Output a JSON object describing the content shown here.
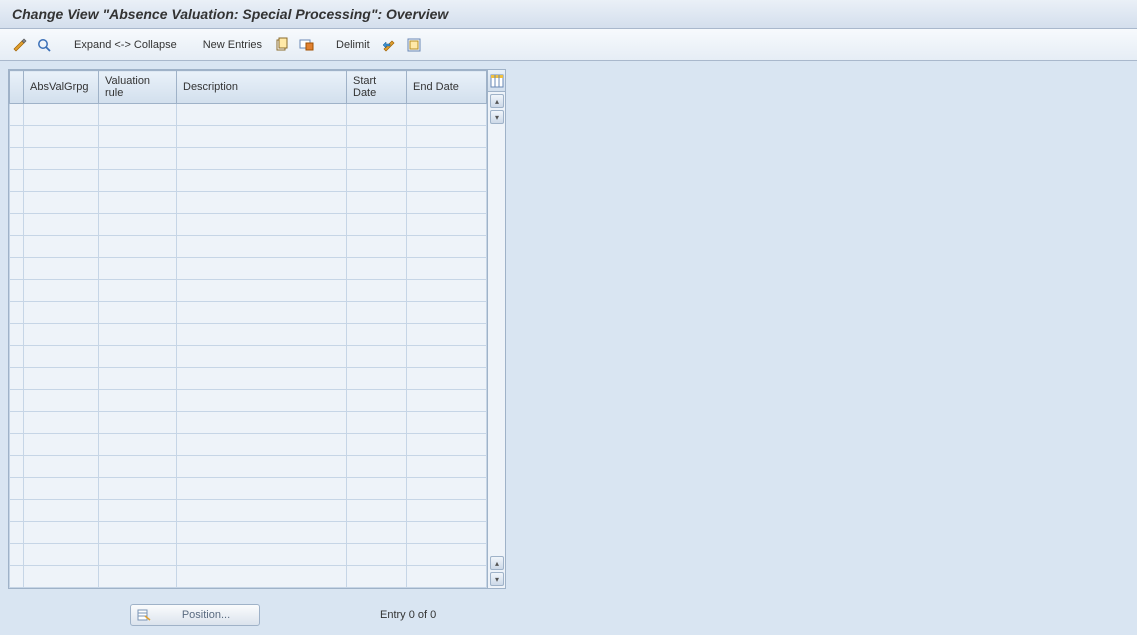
{
  "title": "Change View \"Absence Valuation: Special Processing\": Overview",
  "toolbar": {
    "expand_collapse": "Expand <-> Collapse",
    "new_entries": "New Entries",
    "delimit": "Delimit"
  },
  "table": {
    "headers": {
      "absvalgrpg": "AbsValGrpg",
      "valuation_rule": "Valuation rule",
      "description": "Description",
      "start_date": "Start Date",
      "end_date": "End Date"
    },
    "row_count": 22
  },
  "footer": {
    "position_label": "Position...",
    "entry_text": "Entry 0 of 0"
  }
}
